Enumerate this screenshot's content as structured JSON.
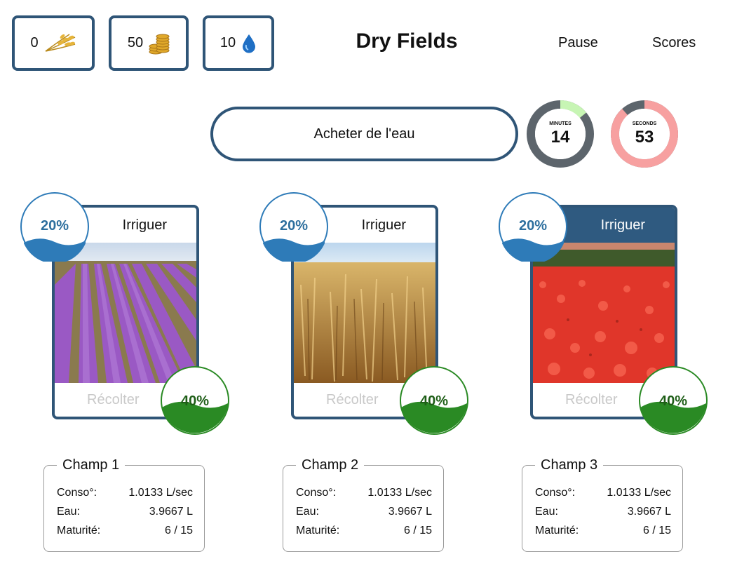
{
  "resources": [
    {
      "value": "0",
      "icon": "wheat-icon"
    },
    {
      "value": "50",
      "icon": "coins-icon"
    },
    {
      "value": "10",
      "icon": "water-drop-icon"
    }
  ],
  "title": "Dry Fields",
  "menu": {
    "pause": "Pause",
    "scores": "Scores"
  },
  "buy_water": "Acheter de l'eau",
  "timers": {
    "minutes": {
      "label": "MINUTES",
      "value": "14",
      "fraction": 0.14,
      "fill_color": "#c7f5b4",
      "track_color": "#5d656c"
    },
    "seconds": {
      "label": "SECONDS",
      "value": "53",
      "fraction": 0.883,
      "fill_color": "#f7a0a0",
      "track_color": "#5d656c"
    }
  },
  "fields": [
    {
      "irrigate": "Irriguer",
      "harvest": "Récolter",
      "water_level": "20%",
      "maturity_level": "40%",
      "photo": "lavender-field",
      "active": false
    },
    {
      "irrigate": "Irriguer",
      "harvest": "Récolter",
      "water_level": "20%",
      "maturity_level": "40%",
      "photo": "wheat-field",
      "active": false
    },
    {
      "irrigate": "Irriguer",
      "harvest": "Récolter",
      "water_level": "20%",
      "maturity_level": "40%",
      "photo": "poppy-field",
      "active": true
    }
  ],
  "stats": [
    {
      "title": "Champ 1",
      "rows": [
        {
          "label": "Conso°:",
          "value": "1.0133 L/sec"
        },
        {
          "label": "Eau:",
          "value": "3.9667 L"
        },
        {
          "label": "Maturité:",
          "value": "6 / 15"
        }
      ]
    },
    {
      "title": "Champ 2",
      "rows": [
        {
          "label": "Conso°:",
          "value": "1.0133 L/sec"
        },
        {
          "label": "Eau:",
          "value": "3.9667 L"
        },
        {
          "label": "Maturité:",
          "value": "6 / 15"
        }
      ]
    },
    {
      "title": "Champ 3",
      "rows": [
        {
          "label": "Conso°:",
          "value": "1.0133 L/sec"
        },
        {
          "label": "Eau:",
          "value": "3.9667 L"
        },
        {
          "label": "Maturité:",
          "value": "6 / 15"
        }
      ]
    }
  ],
  "colors": {
    "accent": "#2f5577",
    "water": "#2e7bb8",
    "water_text": "#2d6f9e",
    "maturity": "#2a8a24",
    "maturity_text": "#1e5e17"
  }
}
